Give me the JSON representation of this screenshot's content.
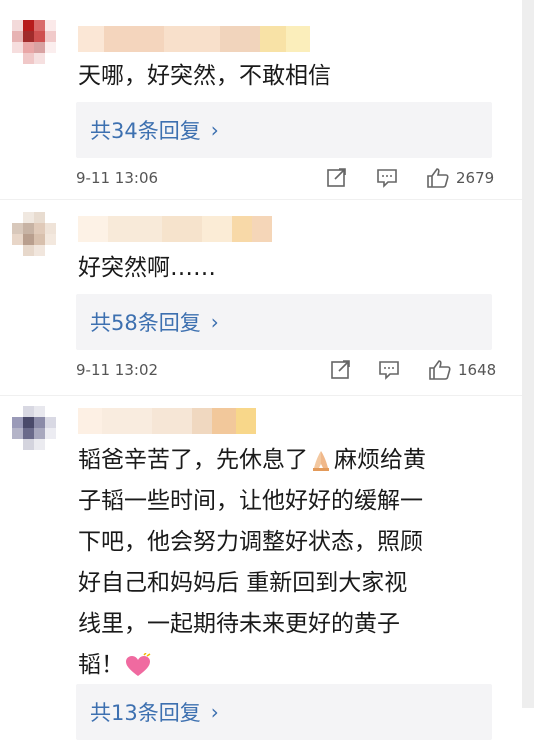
{
  "comments": [
    {
      "text": "天哪，好突然，不敢相信",
      "replies": "共34条回复",
      "time": "9-11 13:06",
      "likes": "2679"
    },
    {
      "text": "好突然啊……",
      "replies": "共58条回复",
      "time": "9-11 13:02",
      "likes": "1648"
    },
    {
      "lines": [
        "韬爸辛苦了，先休息了",
        "麻烦给黄",
        "子韬一些时间，让他好好的缓解一",
        "下吧，他会努力调整好状态，照顾",
        "好自己和妈妈后 重新回到大家视",
        "线里，一起期待未来更好的黄子",
        "韬！"
      ],
      "replies": "共13条回复"
    }
  ],
  "icons": {
    "share": "share-icon",
    "comment": "comment-icon",
    "like": "thumbs-up-icon",
    "chevron": "chevron-right-icon",
    "pray": "pray-emoji",
    "heart": "heart-emoji"
  },
  "colors": {
    "link": "#3d70b0",
    "reply_bg": "#f4f4f6",
    "meta": "#555555"
  }
}
